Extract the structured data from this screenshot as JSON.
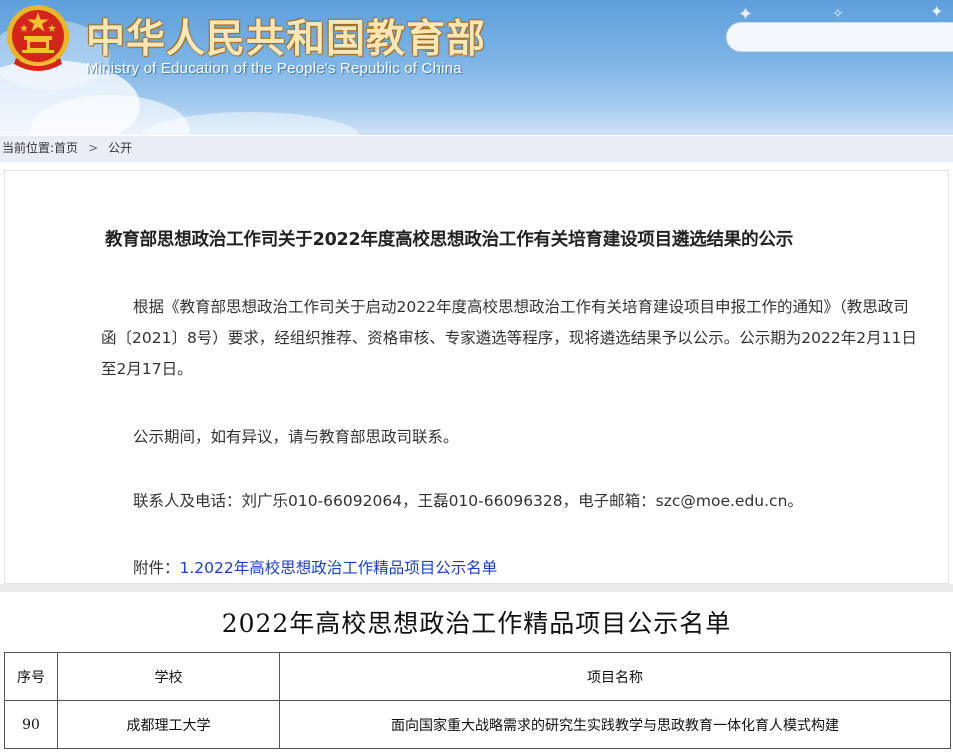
{
  "header": {
    "site_title": "中华人民共和国教育部",
    "site_subtitle": "Ministry of Education of the People's Republic of China",
    "search_placeholder": ""
  },
  "breadcrumb": {
    "label": "当前位置:",
    "items": [
      "首页",
      "公开"
    ],
    "separator": ">"
  },
  "article": {
    "title": "教育部思想政治工作司关于2022年度高校思想政治工作有关培育建设项目遴选结果的公示",
    "paragraphs": [
      "根据《教育部思想政治工作司关于启动2022年度高校思想政治工作有关培育建设项目申报工作的通知》（教思政司函〔2021〕8号）要求，经组织推荐、资格审核、专家遴选等程序，现将遴选结果予以公示。公示期为2022年2月11日至2月17日。",
      "公示期间，如有异议，请与教育部思政司联系。",
      "联系人及电话：刘广乐010-66092064，王磊010-66096328，电子邮箱：szc@moe.edu.cn。"
    ],
    "attachment_label": "附件：",
    "attachment_link": "1.2022年高校思想政治工作精品项目公示名单"
  },
  "attachment_table": {
    "title": "2022年高校思想政治工作精品项目公示名单",
    "headers": [
      "序号",
      "学校",
      "项目名称"
    ],
    "rows": [
      [
        "90",
        "成都理工大学",
        "面向国家重大战略需求的研究生实践教学与思政教育一体化育人模式构建"
      ]
    ]
  },
  "colors": {
    "header_sky": "#6fa9e0",
    "link_blue": "#1a3fcf",
    "title_gold": "#f8e6b4",
    "emblem_red": "#d4251c",
    "emblem_gold": "#f2c230"
  }
}
